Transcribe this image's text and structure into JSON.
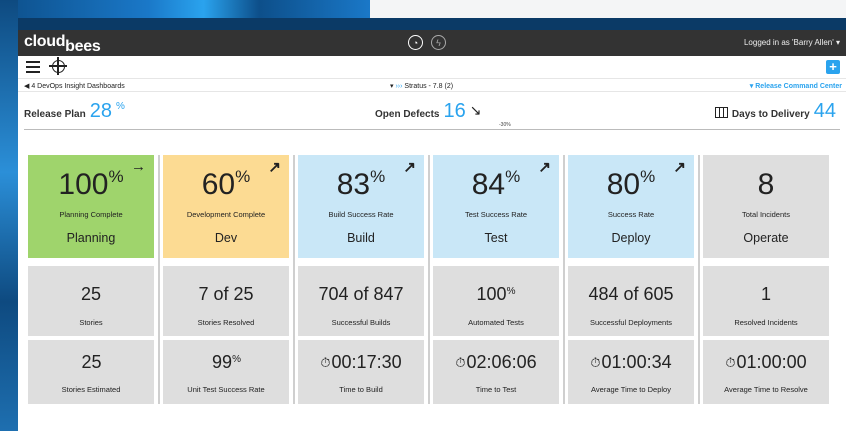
{
  "app": {
    "logo_main": "cloud",
    "logo_sub": "bees",
    "login_text": "Logged in as 'Barry Allen' ▾"
  },
  "nav": {
    "back": "◀ 4 DevOps Insight Dashboards",
    "center_prefix": "▾ ",
    "center_icon": "›››",
    "center_text": " Stratus - 7.8 (2)",
    "right": "▾ Release Command Center"
  },
  "summary": {
    "release_plan_label": "Release Plan",
    "release_plan_value": "28",
    "release_plan_unit": "%",
    "open_defects_label": "Open Defects",
    "open_defects_value": "16",
    "open_defects_arrow": "↘",
    "open_defects_change": "-30%",
    "days_label": "Days to Delivery",
    "days_value": "44"
  },
  "columns": [
    {
      "big": "100",
      "unit": "%",
      "desc": "Planning Complete",
      "stage": "Planning",
      "arrow": "→",
      "color": "green",
      "r2_value": "25",
      "r2_unit": "",
      "r2_label": "Stories",
      "r3_value": "25",
      "r3_unit": "",
      "r3_label": "Stories Estimated",
      "r3_timer": ""
    },
    {
      "big": "60",
      "unit": "%",
      "desc": "Development Complete",
      "stage": "Dev",
      "arrow": "↗",
      "color": "orange",
      "r2_value": "7 of 25",
      "r2_unit": "",
      "r2_label": "Stories Resolved",
      "r3_value": "99",
      "r3_unit": "%",
      "r3_label": "Unit Test Success Rate",
      "r3_timer": ""
    },
    {
      "big": "83",
      "unit": "%",
      "desc": "Build Success Rate",
      "stage": "Build",
      "arrow": "↗",
      "color": "blue",
      "r2_value": "704 of 847",
      "r2_unit": "",
      "r2_label": "Successful Builds",
      "r3_value": "00:17:30",
      "r3_unit": "",
      "r3_label": "Time to Build",
      "r3_timer": "⏱"
    },
    {
      "big": "84",
      "unit": "%",
      "desc": "Test Success Rate",
      "stage": "Test",
      "arrow": "↗",
      "color": "blue",
      "r2_value": "100",
      "r2_unit": "%",
      "r2_label": "Automated Tests",
      "r3_value": "02:06:06",
      "r3_unit": "",
      "r3_label": "Time to Test",
      "r3_timer": "⏱"
    },
    {
      "big": "80",
      "unit": "%",
      "desc": "Success Rate",
      "stage": "Deploy",
      "arrow": "↗",
      "color": "blue",
      "r2_value": "484 of 605",
      "r2_unit": "",
      "r2_label": "Successful Deployments",
      "r3_value": "01:00:34",
      "r3_unit": "",
      "r3_label": "Average Time to Deploy",
      "r3_timer": "⏱"
    },
    {
      "big": "8",
      "unit": "",
      "desc": "Total Incidents",
      "stage": "Operate",
      "arrow": "",
      "color": "gray",
      "r2_value": "1",
      "r2_unit": "",
      "r2_label": "Resolved Incidents",
      "r3_value": "01:00:00",
      "r3_unit": "",
      "r3_label": "Average Time to Resolve",
      "r3_timer": "⏱"
    }
  ]
}
